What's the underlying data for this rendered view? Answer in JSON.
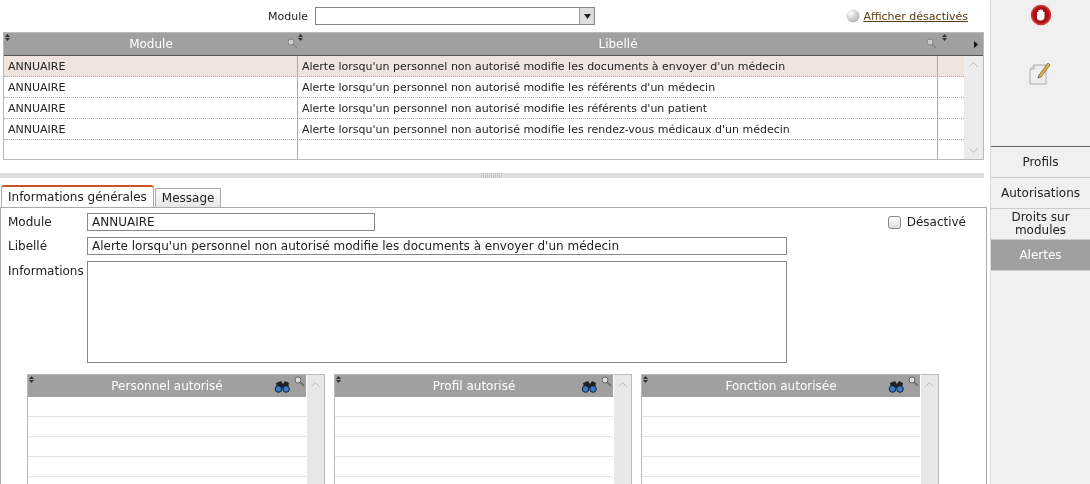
{
  "filter": {
    "label": "Module"
  },
  "show_disabled_link": "Afficher désactivés",
  "table": {
    "columns": [
      "Module",
      "Libellé"
    ],
    "rows": [
      {
        "module": "ANNUAIRE",
        "label": "Alerte lorsqu'un personnel non autorisé modifie les documents à envoyer d'un médecin",
        "selected": true
      },
      {
        "module": "ANNUAIRE",
        "label": "Alerte lorsqu'un personnel non autorisé modifie les référents d'un médecin",
        "selected": false
      },
      {
        "module": "ANNUAIRE",
        "label": "Alerte lorsqu'un personnel non autorisé modifie les référents d'un patient",
        "selected": false
      },
      {
        "module": "ANNUAIRE",
        "label": "Alerte lorsqu'un personnel non autorisé modifie les rendez-vous médicaux d'un médecin",
        "selected": false
      }
    ]
  },
  "tabs": [
    {
      "label": "Informations générales",
      "selected": true
    },
    {
      "label": "Message",
      "selected": false
    }
  ],
  "form": {
    "module": {
      "label": "Module",
      "value": "ANNUAIRE"
    },
    "libelle": {
      "label": "Libellé",
      "value": "Alerte lorsqu'un personnel non autorisé modifie les documents à envoyer d'un médecin"
    },
    "informations": {
      "label": "Informations"
    },
    "disabled": {
      "label": "Désactivé",
      "checked": false
    }
  },
  "grids": [
    {
      "title": "Personnel autorisé"
    },
    {
      "title": "Profil autorisé"
    },
    {
      "title": "Fonction autorisée"
    }
  ],
  "sidebar": {
    "items": [
      {
        "label": "Profils",
        "selected": false
      },
      {
        "label": "Autorisations",
        "selected": false
      },
      {
        "label": "Droits sur modules",
        "selected": false
      },
      {
        "label": "Alertes",
        "selected": true
      }
    ]
  }
}
